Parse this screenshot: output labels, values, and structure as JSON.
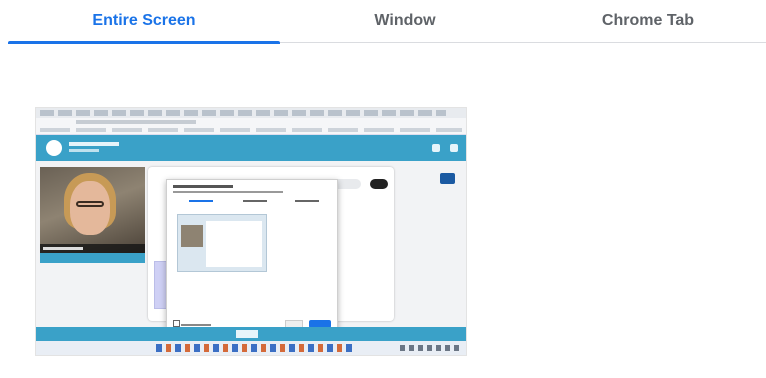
{
  "tabs": [
    {
      "label": "Entire Screen",
      "active": true
    },
    {
      "label": "Window",
      "active": false
    },
    {
      "label": "Chrome Tab",
      "active": false
    }
  ],
  "accent_color": "#1a73e8",
  "preview": {
    "kind": "screen-thumbnail",
    "app_bar_color": "#3aa1c8"
  }
}
